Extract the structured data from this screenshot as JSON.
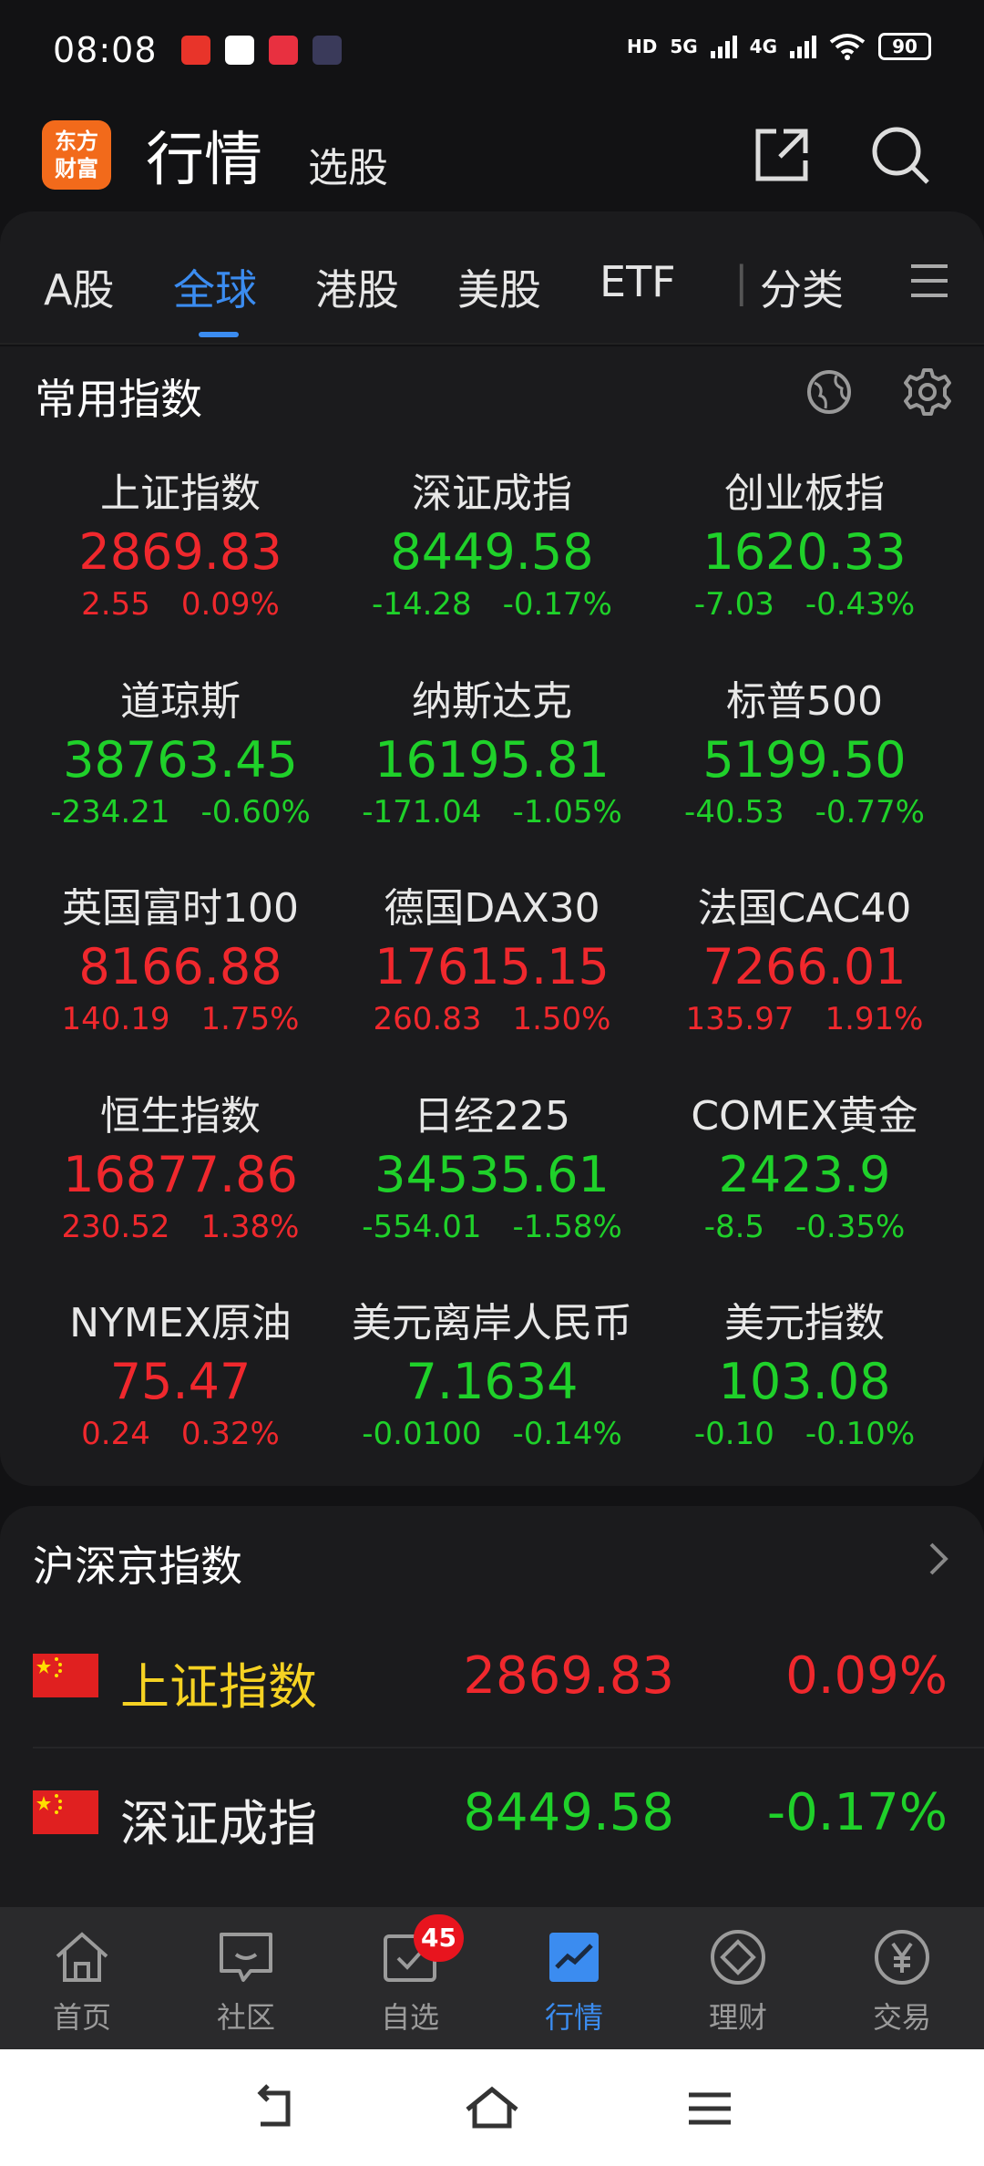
{
  "status_bar": {
    "time": "08:08",
    "signal_hd": "HD",
    "signal_5g": "5G",
    "signal_4g": "4G",
    "battery": "90"
  },
  "header": {
    "logo_text": "东方财富",
    "title": "行情",
    "subtitle": "选股"
  },
  "tabs": {
    "items": [
      "A股",
      "全球",
      "港股",
      "美股",
      "ETF",
      "分类"
    ],
    "active": "全球"
  },
  "common_indices": {
    "title": "常用指数",
    "items": [
      {
        "name": "上证指数",
        "price": "2869.83",
        "change": "2.55",
        "pct": "0.09%"
      },
      {
        "name": "深证成指",
        "price": "8449.58",
        "change": "-14.28",
        "pct": "-0.17%"
      },
      {
        "name": "创业板指",
        "price": "1620.33",
        "change": "-7.03",
        "pct": "-0.43%"
      },
      {
        "name": "道琼斯",
        "price": "38763.45",
        "change": "-234.21",
        "pct": "-0.60%"
      },
      {
        "name": "纳斯达克",
        "price": "16195.81",
        "change": "-171.04",
        "pct": "-1.05%"
      },
      {
        "name": "标普500",
        "price": "5199.50",
        "change": "-40.53",
        "pct": "-0.77%"
      },
      {
        "name": "英国富时100",
        "price": "8166.88",
        "change": "140.19",
        "pct": "1.75%"
      },
      {
        "name": "德国DAX30",
        "price": "17615.15",
        "change": "260.83",
        "pct": "1.50%"
      },
      {
        "name": "法国CAC40",
        "price": "7266.01",
        "change": "135.97",
        "pct": "1.91%"
      },
      {
        "name": "恒生指数",
        "price": "16877.86",
        "change": "230.52",
        "pct": "1.38%"
      },
      {
        "name": "日经225",
        "price": "34535.61",
        "change": "-554.01",
        "pct": "-1.58%"
      },
      {
        "name": "COMEX黄金",
        "price": "2423.9",
        "change": "-8.5",
        "pct": "-0.35%"
      },
      {
        "name": "NYMEX原油",
        "price": "75.47",
        "change": "0.24",
        "pct": "0.32%"
      },
      {
        "name": "美元离岸人民币",
        "price": "7.1634",
        "change": "-0.0100",
        "pct": "-0.14%"
      },
      {
        "name": "美元指数",
        "price": "103.08",
        "change": "-0.10",
        "pct": "-0.10%"
      }
    ]
  },
  "hs_indices": {
    "title": "沪深京指数",
    "rows": [
      {
        "name": "上证指数",
        "price": "2869.83",
        "pct": "0.09%"
      },
      {
        "name": "深证成指",
        "price": "8449.58",
        "pct": "-0.17%"
      }
    ]
  },
  "bottom_nav": {
    "items": [
      "首页",
      "社区",
      "自选",
      "行情",
      "理财",
      "交易"
    ],
    "active": "行情",
    "badge": "45"
  },
  "colors": {
    "up": "#f0282d",
    "down": "#1fd12a",
    "accent": "#3b8cf0",
    "brand": "#f26a1b"
  }
}
